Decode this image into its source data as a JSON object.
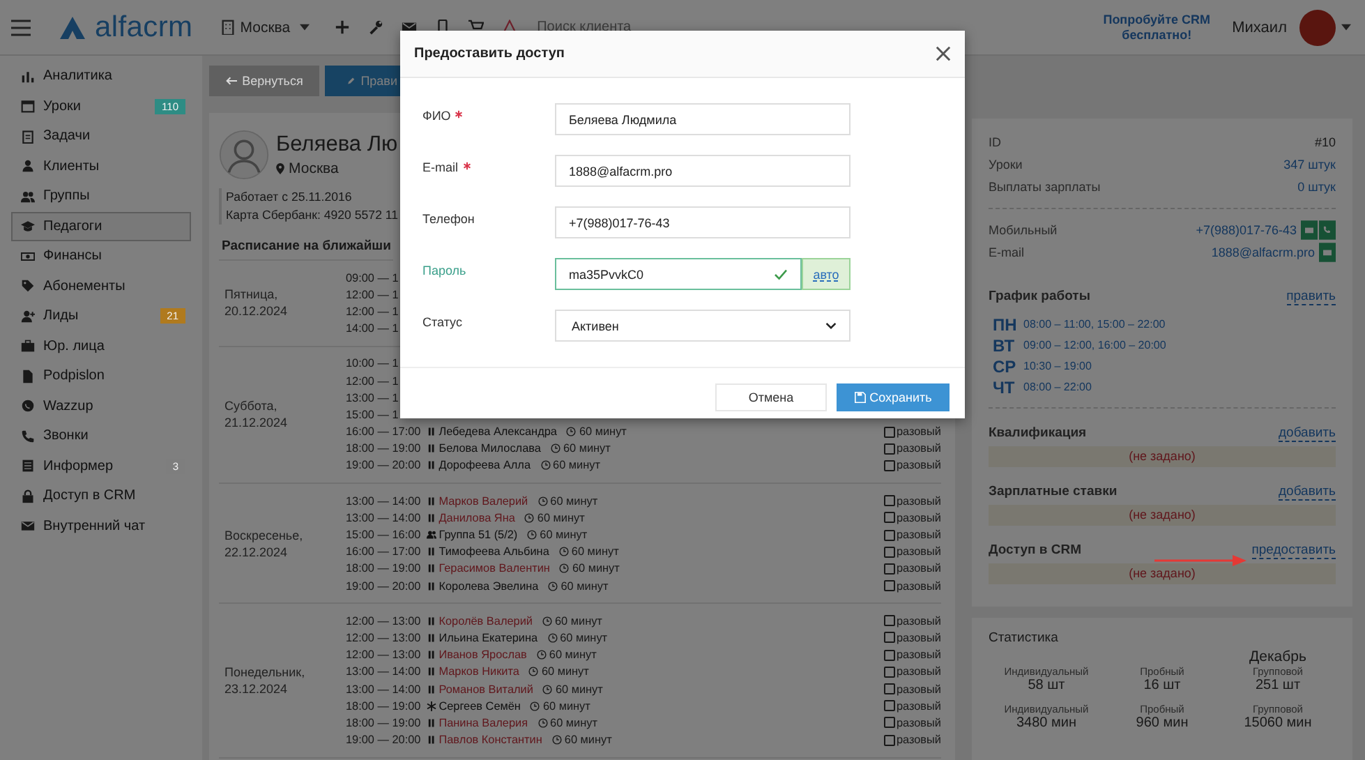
{
  "header": {
    "logo": "alfacrm",
    "branch": "Москва",
    "search": {
      "placeholder": "Поиск клиента"
    },
    "promo": "Попробуйте CRM бесплатно!",
    "user": "Михаил"
  },
  "sidebar": {
    "items": [
      {
        "label": "Аналитика",
        "selected": false
      },
      {
        "label": "Уроки",
        "selected": false,
        "badge": {
          "text": "110",
          "color": "#2e8c84"
        }
      },
      {
        "label": "Задачи",
        "selected": false
      },
      {
        "label": "Клиенты",
        "selected": false
      },
      {
        "label": "Группы",
        "selected": false
      },
      {
        "label": "Педагоги",
        "selected": true
      },
      {
        "label": "Финансы",
        "selected": false
      },
      {
        "label": "Абонементы",
        "selected": false
      },
      {
        "label": "Лиды",
        "selected": false,
        "badge": {
          "text": "21",
          "color": "#b07a1e"
        }
      },
      {
        "label": "Юр. лица",
        "selected": false
      },
      {
        "label": "Podpislon",
        "selected": false
      },
      {
        "label": "Wazzup",
        "selected": false
      },
      {
        "label": "Звонки",
        "selected": false
      },
      {
        "label": "Информер",
        "selected": false,
        "badge": {
          "text": "3",
          "color": "#7e7e7e"
        }
      },
      {
        "label": "Доступ в CRM",
        "selected": false
      },
      {
        "label": "Внутренний чат",
        "selected": false
      }
    ]
  },
  "toolbar": {
    "back": "Вернуться",
    "edit": "Прави"
  },
  "profile": {
    "name": "Беляева Лю",
    "city": "Москва",
    "details": [
      "Работает с 25.11.2016",
      "Карта Сбербанк: 4920 5572 11"
    ]
  },
  "schedule": {
    "title": "Расписание на ближайши",
    "days": [
      {
        "day": "Пятница, 20.12.2024",
        "rows": [
          {
            "kind": "partial",
            "time": "09:00 — 1"
          },
          {
            "kind": "partial",
            "time": "12:00 — 1"
          },
          {
            "kind": "partial",
            "time": "12:00 — 1"
          },
          {
            "kind": "partial",
            "time": "14:00 — 1"
          }
        ]
      },
      {
        "day": "Суббота, 21.12.2024",
        "rows": [
          {
            "kind": "partial",
            "time": "10:00 — 1"
          },
          {
            "kind": "partial",
            "time": "12:00 — 1"
          },
          {
            "kind": "partial",
            "time": "13:00 — 1"
          },
          {
            "kind": "partial",
            "time": "15:00 — 1"
          },
          {
            "kind": "individual",
            "time": "16:00 — 17:00",
            "student": "Лебедева Александра",
            "debt": false,
            "duration": "60 минут",
            "option": "разовый",
            "checked": false
          },
          {
            "kind": "individual",
            "time": "18:00 — 19:00",
            "student": "Белова Милослава",
            "debt": false,
            "duration": "60 минут",
            "option": "разовый",
            "checked": false
          },
          {
            "kind": "individual",
            "time": "19:00 — 20:00",
            "student": "Дорофеева Алла",
            "debt": false,
            "duration": "60 минут",
            "option": "разовый",
            "checked": false
          }
        ]
      },
      {
        "day": "Воскресенье, 22.12.2024",
        "rows": [
          {
            "kind": "individual",
            "time": "13:00 — 14:00",
            "student": "Марков Валерий",
            "debt": true,
            "duration": "60 минут",
            "option": "разовый",
            "checked": false
          },
          {
            "kind": "individual",
            "time": "13:00 — 14:00",
            "student": "Данилова Яна",
            "debt": true,
            "duration": "60 минут",
            "option": "разовый",
            "checked": false
          },
          {
            "kind": "group",
            "time": "15:00 — 16:00",
            "student": "Группа 51 (5/2)",
            "debt": false,
            "duration": "60 минут",
            "option": "разовый",
            "checked": false
          },
          {
            "kind": "individual",
            "time": "16:00 — 17:00",
            "student": "Тимофеева Альбина",
            "debt": false,
            "duration": "60 минут",
            "option": "разовый",
            "checked": false
          },
          {
            "kind": "individual",
            "time": "18:00 — 19:00",
            "student": "Герасимов Валентин",
            "debt": true,
            "duration": "60 минут",
            "option": "разовый",
            "checked": false
          },
          {
            "kind": "individual",
            "time": "19:00 — 20:00",
            "student": "Королева Эвелина",
            "debt": false,
            "duration": "60 минут",
            "option": "разовый",
            "checked": false
          }
        ]
      },
      {
        "day": "Понедельник, 23.12.2024",
        "rows": [
          {
            "kind": "individual",
            "time": "12:00 — 13:00",
            "student": "Королёв Валерий",
            "debt": true,
            "duration": "60 минут",
            "option": "разовый",
            "checked": false
          },
          {
            "kind": "individual",
            "time": "12:00 — 13:00",
            "student": "Ильина Екатерина",
            "debt": false,
            "duration": "60 минут",
            "option": "разовый",
            "checked": false
          },
          {
            "kind": "individual",
            "time": "12:00 — 13:00",
            "student": "Иванов Ярослав",
            "debt": true,
            "duration": "60 минут",
            "option": "разовый",
            "checked": false
          },
          {
            "kind": "individual",
            "time": "13:00 — 14:00",
            "student": "Марков Никита",
            "debt": true,
            "duration": "60 минут",
            "option": "разовый",
            "checked": false
          },
          {
            "kind": "individual",
            "time": "13:00 — 14:00",
            "student": "Романов Виталий",
            "debt": true,
            "duration": "60 минут",
            "option": "разовый",
            "checked": false
          },
          {
            "kind": "trial",
            "time": "18:00 — 19:00",
            "student": "Сергеев Семён",
            "debt": false,
            "duration": "60 минут",
            "option": "разовый",
            "checked": false
          },
          {
            "kind": "individual",
            "time": "18:00 — 19:00",
            "student": "Панина Валерия",
            "debt": true,
            "duration": "60 минут",
            "option": "разовый",
            "checked": false
          },
          {
            "kind": "individual",
            "time": "19:00 — 20:00",
            "student": "Павлов Константин",
            "debt": true,
            "duration": "60 минут",
            "option": "разовый",
            "checked": false
          }
        ]
      }
    ]
  },
  "info_card": {
    "rows": [
      {
        "label": "ID",
        "value": "#10",
        "link": false
      },
      {
        "label": "Уроки",
        "value": "347 штук",
        "link": true
      },
      {
        "label": "Выплаты зарплаты",
        "value": "0 штук",
        "link": true
      }
    ],
    "contacts": [
      {
        "label": "Мобильный",
        "value": "+7(988)017-76-43",
        "message": true,
        "call": true
      },
      {
        "label": "E-mail",
        "value": "1888@alfacrm.pro",
        "message": true,
        "call": false
      }
    ],
    "work_schedule": {
      "title": "График работы",
      "action": "править",
      "days": [
        {
          "day": "ПН",
          "hours": "08:00 – 11:00, 15:00 – 22:00"
        },
        {
          "day": "ВТ",
          "hours": "09:00 – 12:00, 16:00 – 20:00"
        },
        {
          "day": "СР",
          "hours": "10:30 – 19:00"
        },
        {
          "day": "ЧТ",
          "hours": "08:00 – 22:00"
        }
      ]
    },
    "sections": [
      {
        "title": "Квалификация",
        "action": "добавить",
        "value": "(не задано)",
        "pointed": false
      },
      {
        "title": "Зарплатные ставки",
        "action": "добавить",
        "value": "(не задано)",
        "pointed": false
      },
      {
        "title": "Доступ в CRM",
        "action": "предоставить",
        "value": "(не задано)",
        "pointed": true
      }
    ]
  },
  "stats": {
    "title": "Статистика",
    "month": "Декабрь",
    "items": [
      {
        "label": "Индивидуальный",
        "value": "58 шт"
      },
      {
        "label": "Пробный",
        "value": "16 шт"
      },
      {
        "label": "Групповой",
        "value": "251 шт"
      },
      {
        "label": "Индивидуальный",
        "value": "3480 мин"
      },
      {
        "label": "Пробный",
        "value": "960 мин"
      },
      {
        "label": "Групповой",
        "value": "15060 мин"
      }
    ]
  },
  "modal": {
    "title": "Предоставить доступ",
    "fields": [
      {
        "kind": "text",
        "label": "ФИО",
        "required": true,
        "valid": false,
        "value": "Беляева Людмила"
      },
      {
        "kind": "text",
        "label": "E-mail",
        "required": true,
        "valid": false,
        "value": "1888@alfacrm.pro"
      },
      {
        "kind": "text",
        "label": "Телефон",
        "required": false,
        "valid": false,
        "value": "+7(988)017-76-43"
      },
      {
        "kind": "password",
        "label": "Пароль",
        "required": false,
        "valid": true,
        "value": "ma35PvvkC0",
        "button": "авто"
      },
      {
        "kind": "select",
        "label": "Статус",
        "required": false,
        "valid": false,
        "value": "Активен"
      }
    ],
    "cancel": "Отмена",
    "save": "Сохранить"
  }
}
